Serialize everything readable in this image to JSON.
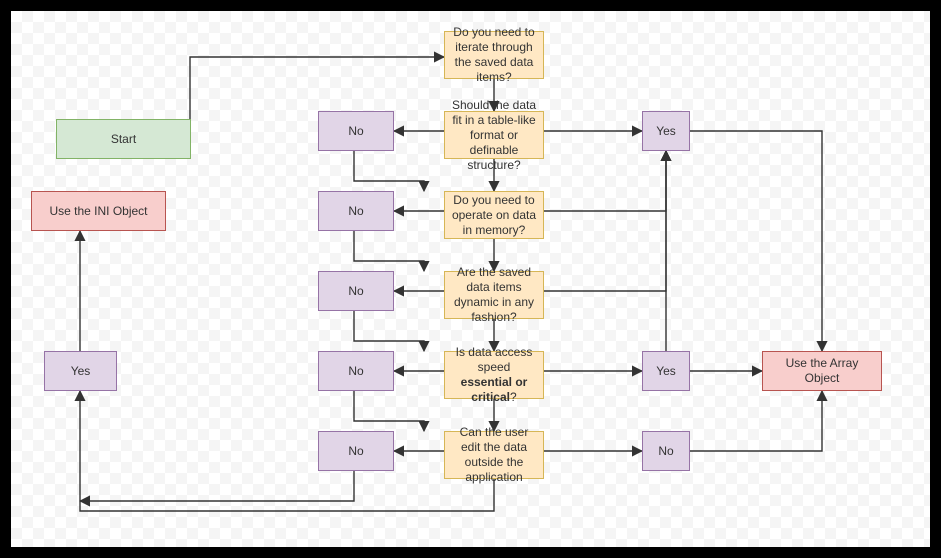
{
  "labels": {
    "yes": "Yes",
    "no": "No"
  },
  "nodes": {
    "start": "Start",
    "use_ini": "Use the INI Object",
    "use_array": "Use the Array Object",
    "q1": "Do you need to iterate through the saved data items?",
    "q2": "Should the data fit in a table-like format or definable structure?",
    "q3": "Do you need to operate on data in memory?",
    "q4": "Are the saved data items dynamic in any fashion?",
    "q5_plain": "Is data access speed essential or critical?",
    "q6": "Can the user edit the data outside the application"
  },
  "chart_data": {
    "type": "flowchart",
    "nodes": [
      {
        "id": "start",
        "kind": "start",
        "label": "Start"
      },
      {
        "id": "q1",
        "kind": "decision",
        "label": "Do you need to iterate through the saved data items?"
      },
      {
        "id": "q2",
        "kind": "decision",
        "label": "Should the data fit in a table-like format or definable structure?"
      },
      {
        "id": "q3",
        "kind": "decision",
        "label": "Do you need to operate on data in memory?"
      },
      {
        "id": "q4",
        "kind": "decision",
        "label": "Are the saved data items dynamic in any fashion?"
      },
      {
        "id": "q5",
        "kind": "decision",
        "label": "Is data access speed essential or critical?"
      },
      {
        "id": "q6",
        "kind": "decision",
        "label": "Can the user edit the data outside the application"
      },
      {
        "id": "ini",
        "kind": "terminal",
        "label": "Use the INI Object"
      },
      {
        "id": "array",
        "kind": "terminal",
        "label": "Use the Array Object"
      }
    ],
    "edges": [
      {
        "from": "start",
        "to": "q1"
      },
      {
        "from": "q1",
        "to": "array",
        "label": "Yes"
      },
      {
        "from": "q1",
        "to": "q2",
        "label": "No"
      },
      {
        "from": "q2",
        "to": "array",
        "label": "Yes"
      },
      {
        "from": "q2",
        "to": "q3",
        "label": "No"
      },
      {
        "from": "q3",
        "to": "array",
        "label": "Yes"
      },
      {
        "from": "q3",
        "to": "q4",
        "label": "No"
      },
      {
        "from": "q4",
        "to": "array",
        "label": "Yes"
      },
      {
        "from": "q4",
        "to": "q5",
        "label": "No"
      },
      {
        "from": "q5",
        "to": "array",
        "label": "Yes"
      },
      {
        "from": "q5",
        "to": "q6",
        "label": "No"
      },
      {
        "from": "q6",
        "to": "array",
        "label": "No"
      },
      {
        "from": "q6",
        "to": "ini",
        "label": "Yes"
      }
    ]
  }
}
